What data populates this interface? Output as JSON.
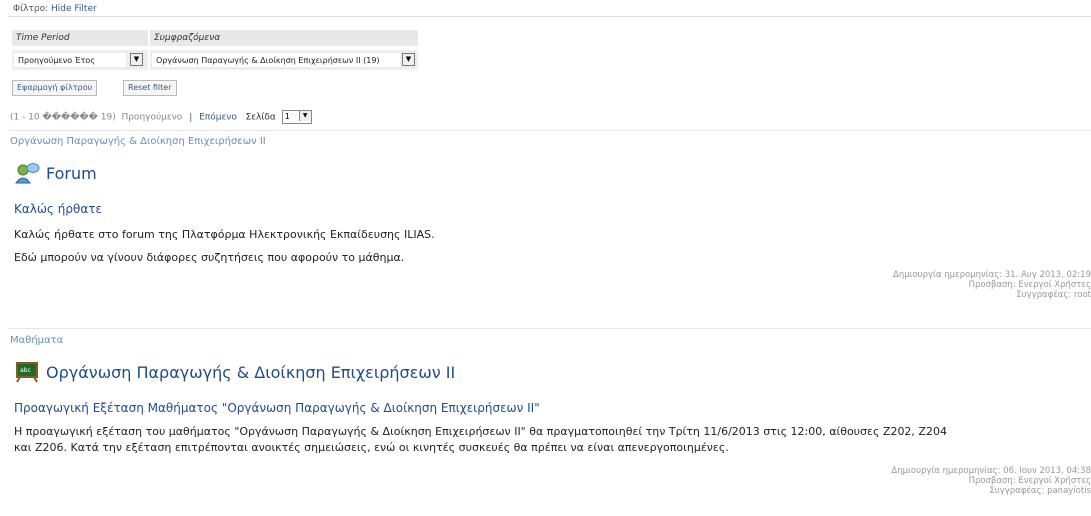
{
  "filter": {
    "legend_label": "Φίλτρο:",
    "legend_link": "Hide Filter",
    "headers": [
      "Time Period",
      "Συμφραζόμενα"
    ],
    "time_period_value": "Προηγούμενο Έτος",
    "context_value": "Οργάνωση Παραγωγής & Διοίκηση Επιχειρήσεων ΙΙ (19)",
    "apply_button": "Εφαρμογή φίλτρου",
    "reset_button": "Reset filter"
  },
  "pagination": {
    "range": "(1 - 10 ������ 19)",
    "previous": "Προηγούμενο",
    "divider": "|",
    "next": "Επόμενο",
    "page_label": "Σελίδα",
    "page_value": "1"
  },
  "items": [
    {
      "category": "Οργάνωση Παραγωγής & Διοίκηση Επιχειρήσεων ΙΙ",
      "object_title": "Forum",
      "icon": "forum-icon",
      "subtitle": "Καλώς ήρθατε",
      "lines": [
        "Καλώς ήρθατε στο forum της Πλατφόρμα Ηλεκτρονικής Εκπαίδευσης ILIAS.",
        "Εδώ μπορούν να γίνουν διάφορες συζητήσεις που αφορούν το μάθημα."
      ],
      "meta_created": "Δημιουργία ημερομηνίας: 31. Αυγ 2013, 02:19",
      "meta_access": "Προσβαση: Ενεργοί Χρήστες",
      "meta_author": "Συγγραφέας: root"
    },
    {
      "category": "Μαθήματα",
      "object_title": "Οργάνωση Παραγωγής & Διοίκηση Επιχειρήσεων ΙΙ",
      "icon": "course-icon",
      "subtitle": "Προαγωγική Εξέταση Μαθήματος \"Οργάνωση Παραγωγής & Διοίκηση Επιχειρήσεων ΙΙ\"",
      "lines": [
        "Η προαγωγική εξέταση του μαθήματος \"Οργάνωση Παραγωγής & Διοίκηση Επιχειρήσεων ΙΙ\" θα πραγματοποιηθεί την Τρίτη 11/6/2013 στις 12:00, αίθουσες Z202, Z204",
        "και Z206. Κατά την εξέταση επιτρέπονται ανοικτές σημειώσεις, ενώ οι κινητές συσκευές θα πρέπει να είναι απενεργοποιημένες."
      ],
      "meta_created": "Δημιουργία ημερομηνίας: 06. Ιουν 2013, 04:38",
      "meta_access": "Προσβαση: Ενεργοί Χρήστες",
      "meta_author": "Συγγραφέας: panayiotis"
    }
  ]
}
